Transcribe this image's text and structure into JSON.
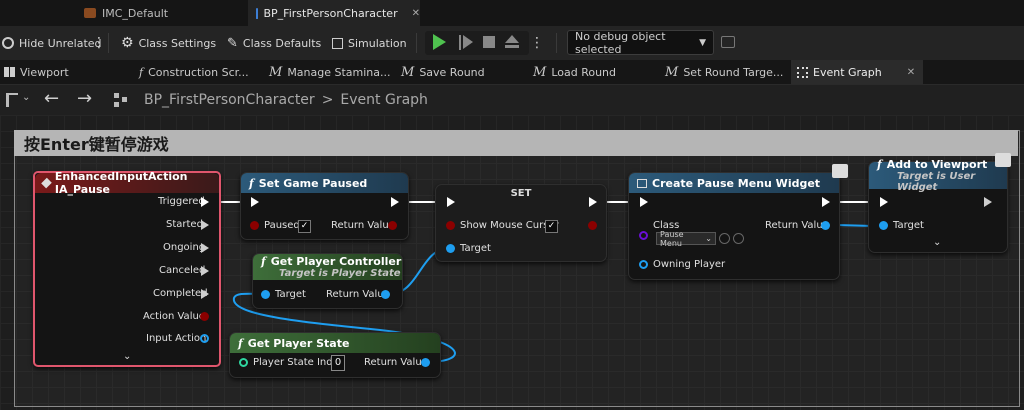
{
  "doc_tabs": [
    {
      "label": "IMC_Default",
      "icon": "input-mapping-icon"
    },
    {
      "label": "BP_FirstPersonCharacter",
      "icon": "blueprint-person-icon",
      "close": "✕"
    }
  ],
  "toolbar": {
    "hide_unrelated": "Hide Unrelated",
    "class_settings": "Class Settings",
    "class_defaults": "Class Defaults",
    "simulation": "Simulation",
    "debug_selector": "No debug object selected"
  },
  "function_tabs": [
    {
      "label": "Viewport",
      "icon": "viewport-icon"
    },
    {
      "label": "Construction Scr...",
      "icon": "function-icon"
    },
    {
      "label": "Manage Stamina...",
      "icon": "macro-icon"
    },
    {
      "label": "Save Round",
      "icon": "macro-icon"
    },
    {
      "label": "Load Round",
      "icon": "macro-icon"
    },
    {
      "label": "Set Round Targe...",
      "icon": "macro-icon"
    },
    {
      "label": "Event Graph",
      "icon": "event-graph-icon",
      "close": "✕"
    }
  ],
  "breadcrumb": {
    "root": "BP_FirstPersonCharacter",
    "separator": ">",
    "current": "Event Graph"
  },
  "comment": {
    "title": "按Enter键暂停游戏"
  },
  "nodes": {
    "input_action": {
      "title": "EnhancedInputAction IA_Pause",
      "pins": [
        "Triggered",
        "Started",
        "Ongoing",
        "Canceled",
        "Completed",
        "Action Value",
        "Input Action"
      ]
    },
    "set_game_paused": {
      "title": "Set Game Paused",
      "in_label": "Paused",
      "out_label": "Return Value"
    },
    "set": {
      "title": "SET",
      "var_label": "Show Mouse Cursor",
      "target_label": "Target"
    },
    "get_player_controller": {
      "title": "Get Player Controller",
      "subtitle": "Target is Player State",
      "in_label": "Target",
      "out_label": "Return Value"
    },
    "get_player_state": {
      "title": "Get Player State",
      "in_label": "Player State Index",
      "index_value": "0",
      "out_label": "Return Value"
    },
    "create_widget": {
      "title": "Create Pause Menu Widget",
      "class_label": "Class",
      "class_value": "Pause Menu",
      "owning_label": "Owning Player",
      "out_label": "Return Value"
    },
    "add_viewport": {
      "title": "Add to Viewport",
      "subtitle": "Target is User Widget",
      "target_label": "Target"
    }
  },
  "colors": {
    "exec": "#ffffff",
    "object_pin": "#1e9ef0",
    "bool_pin": "#8b0000",
    "class_pin": "#6a0fd6",
    "function_header": "#2c5a7a",
    "pure_header": "#3e6e3a",
    "event_header": "#7a1a1a",
    "selection": "#e0566d"
  }
}
